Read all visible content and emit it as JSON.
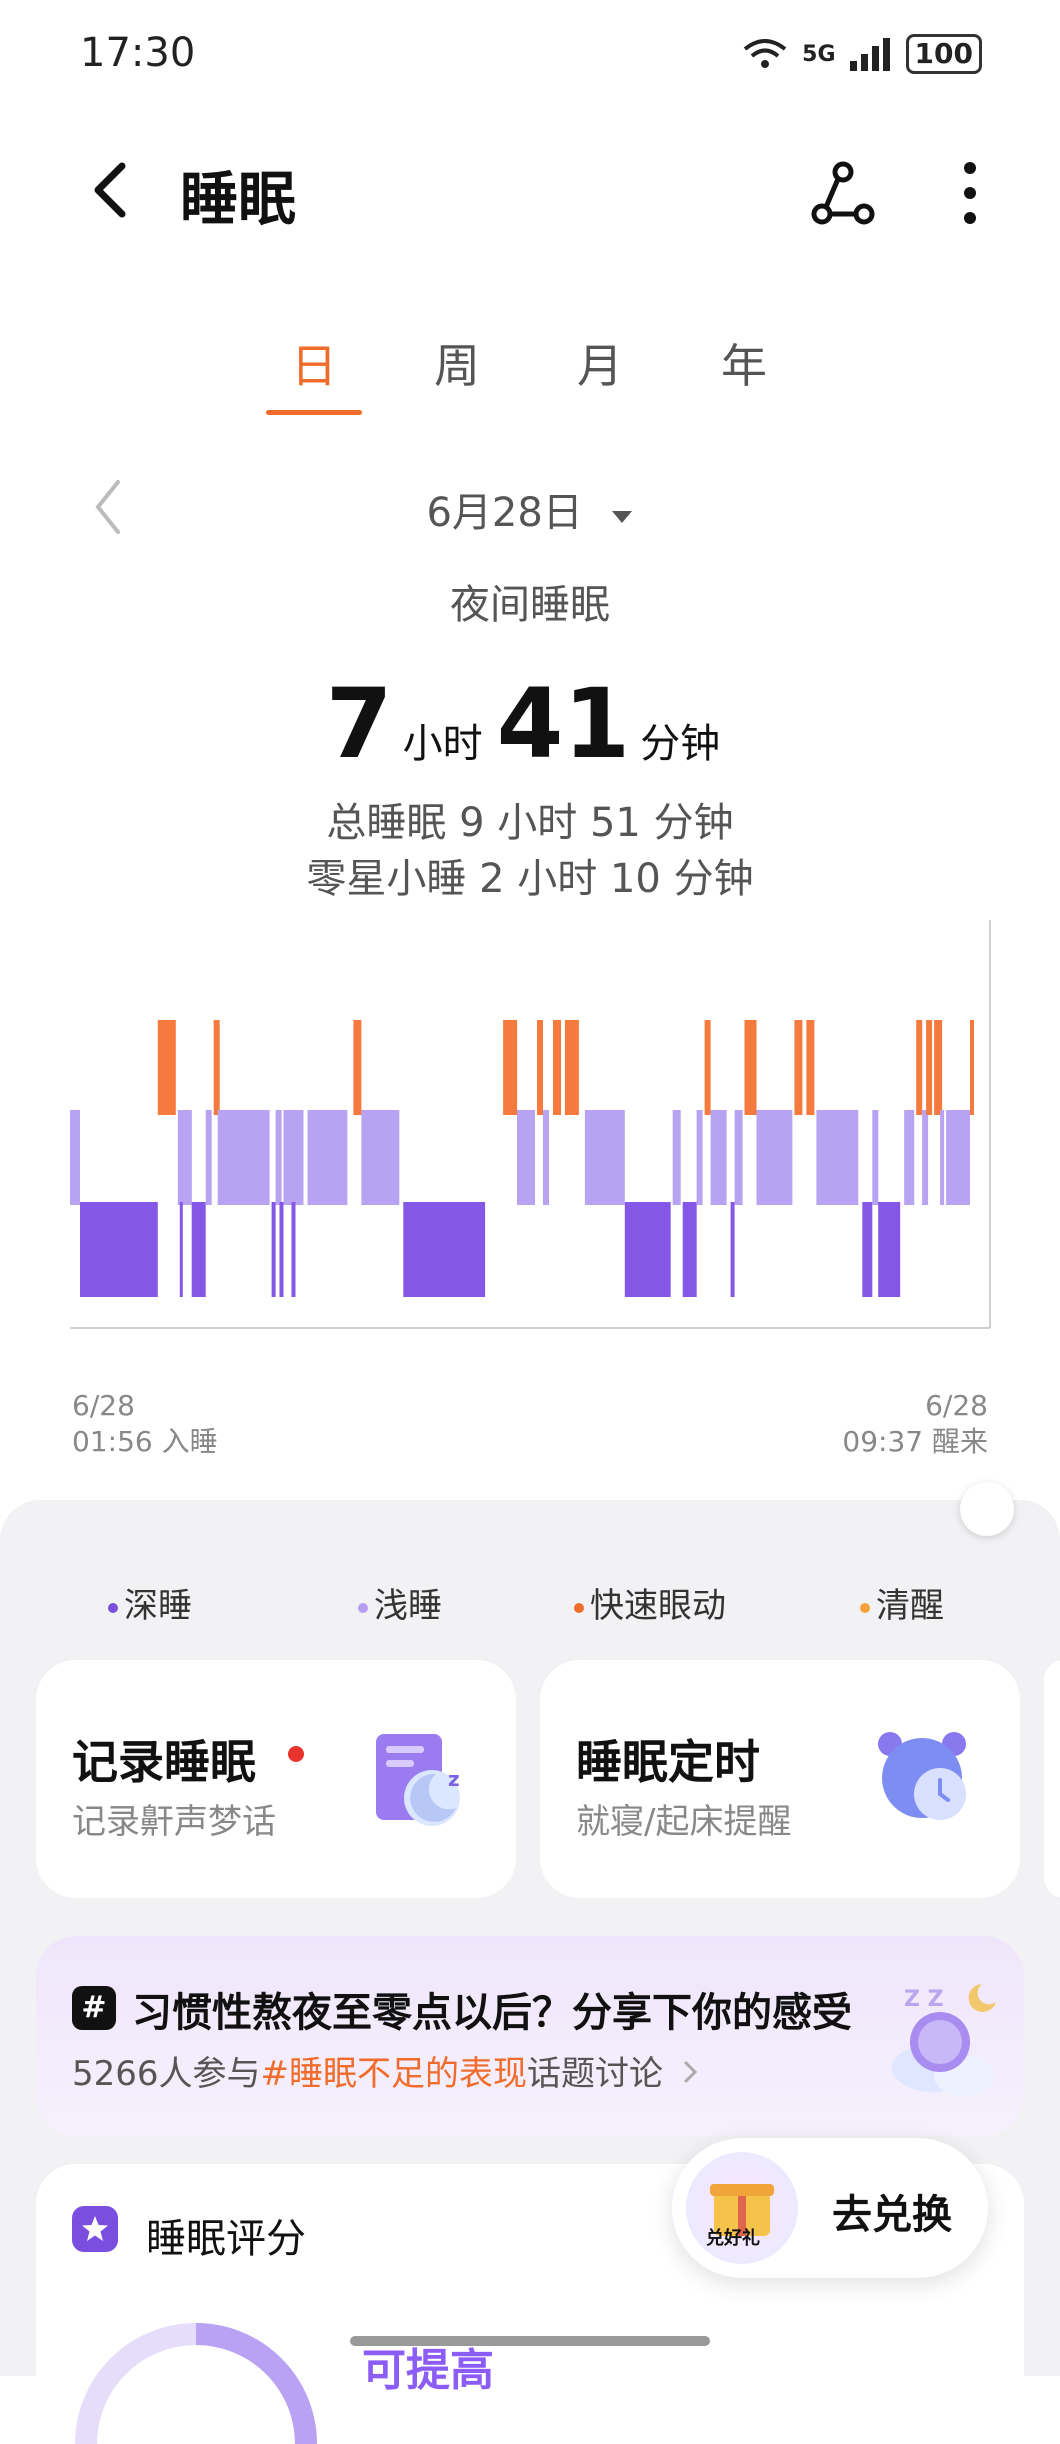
{
  "status_bar": {
    "time": "17:30",
    "network": "5G",
    "battery": "100"
  },
  "header": {
    "title": "睡眠"
  },
  "tabs": [
    {
      "label": "日",
      "active": true
    },
    {
      "label": "周",
      "active": false
    },
    {
      "label": "月",
      "active": false
    },
    {
      "label": "年",
      "active": false
    }
  ],
  "date": {
    "label": "6月28日"
  },
  "summary": {
    "subtitle": "夜间睡眠",
    "hours": "7",
    "hours_unit": "小时",
    "minutes": "41",
    "minutes_unit": "分钟",
    "total_sleep": "总睡眠 9 小时 51 分钟",
    "nap": "零星小睡 2 小时 10 分钟"
  },
  "chart_data": {
    "type": "sleep-stages",
    "start": {
      "date": "6/28",
      "time": "01:56",
      "label": "入睡"
    },
    "end": {
      "date": "6/28",
      "time": "09:37",
      "label": "醒来"
    },
    "stages": [
      "快速眼动",
      "浅睡",
      "深睡"
    ],
    "colors": {
      "快速眼动": "#f47a3d",
      "浅睡": "#b8a2f2",
      "深睡": "#8457e6"
    },
    "segments_minutes": [
      {
        "stage": "浅睡",
        "start": 0,
        "end": 5
      },
      {
        "stage": "深睡",
        "start": 5,
        "end": 44
      },
      {
        "stage": "快速眼动",
        "start": 44,
        "end": 53
      },
      {
        "stage": "浅睡",
        "start": 54,
        "end": 61
      },
      {
        "stage": "深睡",
        "start": 55,
        "end": 56
      },
      {
        "stage": "深睡",
        "start": 61,
        "end": 68
      },
      {
        "stage": "浅睡",
        "start": 68,
        "end": 71
      },
      {
        "stage": "快速眼动",
        "start": 72,
        "end": 75
      },
      {
        "stage": "浅睡",
        "start": 74,
        "end": 100
      },
      {
        "stage": "深睡",
        "start": 101,
        "end": 103
      },
      {
        "stage": "浅睡",
        "start": 103,
        "end": 106
      },
      {
        "stage": "深睡",
        "start": 105,
        "end": 107
      },
      {
        "stage": "浅睡",
        "start": 107,
        "end": 117
      },
      {
        "stage": "深睡",
        "start": 111,
        "end": 113
      },
      {
        "stage": "快速眼动",
        "start": 142,
        "end": 146
      },
      {
        "stage": "浅睡",
        "start": 119,
        "end": 139
      },
      {
        "stage": "浅睡",
        "start": 146,
        "end": 165
      },
      {
        "stage": "深睡",
        "start": 167,
        "end": 208
      },
      {
        "stage": "快速眼动",
        "start": 217,
        "end": 224
      },
      {
        "stage": "浅睡",
        "start": 224,
        "end": 233
      },
      {
        "stage": "快速眼动",
        "start": 234,
        "end": 237
      },
      {
        "stage": "浅睡",
        "start": 237,
        "end": 240
      },
      {
        "stage": "快速眼动",
        "start": 242,
        "end": 246
      },
      {
        "stage": "快速眼动",
        "start": 248,
        "end": 255
      },
      {
        "stage": "浅睡",
        "start": 258,
        "end": 278
      },
      {
        "stage": "深睡",
        "start": 278,
        "end": 301
      },
      {
        "stage": "浅睡",
        "start": 302,
        "end": 306
      },
      {
        "stage": "深睡",
        "start": 307,
        "end": 314
      },
      {
        "stage": "浅睡",
        "start": 314,
        "end": 317
      },
      {
        "stage": "快速眼动",
        "start": 318,
        "end": 321
      },
      {
        "stage": "浅睡",
        "start": 321,
        "end": 329
      },
      {
        "stage": "深睡",
        "start": 331,
        "end": 333
      },
      {
        "stage": "浅睡",
        "start": 333,
        "end": 337
      },
      {
        "stage": "快速眼动",
        "start": 338,
        "end": 344
      },
      {
        "stage": "浅睡",
        "start": 344,
        "end": 362
      },
      {
        "stage": "快速眼动",
        "start": 363,
        "end": 367
      },
      {
        "stage": "快速眼动",
        "start": 369,
        "end": 373
      },
      {
        "stage": "浅睡",
        "start": 374,
        "end": 395
      },
      {
        "stage": "深睡",
        "start": 397,
        "end": 402
      },
      {
        "stage": "浅睡",
        "start": 402,
        "end": 405
      },
      {
        "stage": "深睡",
        "start": 405,
        "end": 416
      },
      {
        "stage": "浅睡",
        "start": 418,
        "end": 423
      },
      {
        "stage": "快速眼动",
        "start": 424,
        "end": 427
      },
      {
        "stage": "浅睡",
        "start": 427,
        "end": 430
      },
      {
        "stage": "快速眼动",
        "start": 429,
        "end": 432
      },
      {
        "stage": "快速眼动",
        "start": 433,
        "end": 437
      },
      {
        "stage": "浅睡",
        "start": 436,
        "end": 438
      },
      {
        "stage": "浅睡",
        "start": 439,
        "end": 451
      },
      {
        "stage": "快速眼动",
        "start": 451,
        "end": 453
      }
    ],
    "total_minutes": 461
  },
  "legend": [
    {
      "label": "深睡",
      "color": "#7a4fe0"
    },
    {
      "label": "浅睡",
      "color": "#b79cf4"
    },
    {
      "label": "快速眼动",
      "color": "#f06c2d"
    },
    {
      "label": "清醒",
      "color": "#f5a23c"
    }
  ],
  "cards": [
    {
      "title": "记录睡眠",
      "subtitle": "记录鼾声梦话"
    },
    {
      "title": "睡眠定时",
      "subtitle": "就寝/起床提醒"
    }
  ],
  "topic": {
    "hash": "#",
    "title": "习惯性熬夜至零点以后？分享下你的感受",
    "participants": "5266人参与",
    "topic_tag": "#睡眠不足的表现",
    "suffix": "话题讨论"
  },
  "score": {
    "title": "睡眠评分",
    "status": "可提高"
  },
  "redeem": {
    "label": "去兑换",
    "gift_text": "兑好礼"
  }
}
